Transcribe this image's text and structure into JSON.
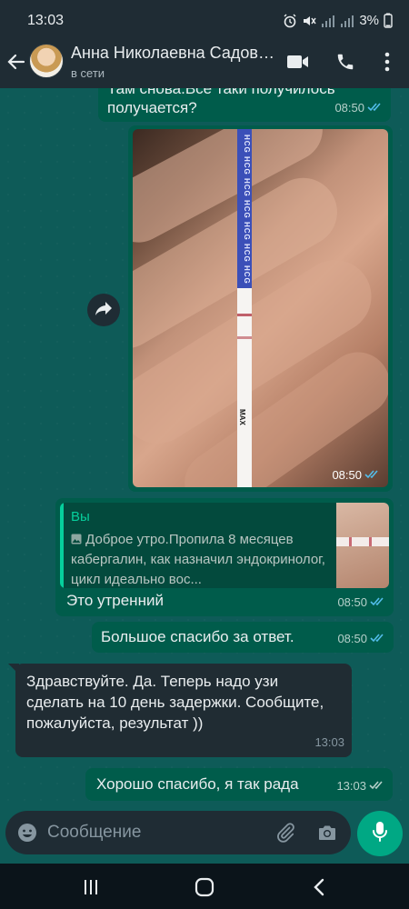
{
  "status_bar": {
    "time": "13:03",
    "battery": "3%"
  },
  "header": {
    "contact_name": "Анна Николаевна Садовничая",
    "presence": "в сети"
  },
  "messages": {
    "m1": {
      "text": "Там снова.Все таки получилось? получается?",
      "line_top": "Там снова.Все таки получилось",
      "line_bottom": "получается?",
      "time": "08:50"
    },
    "m2": {
      "time": "08:50"
    },
    "m3": {
      "quote_author": "Вы",
      "quote_text": "Доброе утро.Пропила 8 месяцев кабергалин, как назначил эндокринолог, цикл идеально вос...",
      "text": "Это утренний",
      "time": "08:50"
    },
    "m4": {
      "text": "Большое спасибо за ответ.",
      "time": "08:50"
    },
    "m5": {
      "text": "Здравствуйте. Да. Теперь надо узи сделать на 10 день задержки. Сообщите, пожалуйста, результат ))",
      "time": "13:03"
    },
    "m6": {
      "text": "Хорошо спасибо, я так рада",
      "time": "13:03"
    }
  },
  "photo_labels": {
    "strip_brand": "HCG HCG HCG HCG HCG HCG HCG",
    "strip_max": "MAX"
  },
  "input": {
    "placeholder": "Сообщение"
  },
  "colors": {
    "outgoing": "#005c4b",
    "incoming": "#202c33",
    "accent": "#00a884",
    "read_ticks": "#53bdeb"
  }
}
